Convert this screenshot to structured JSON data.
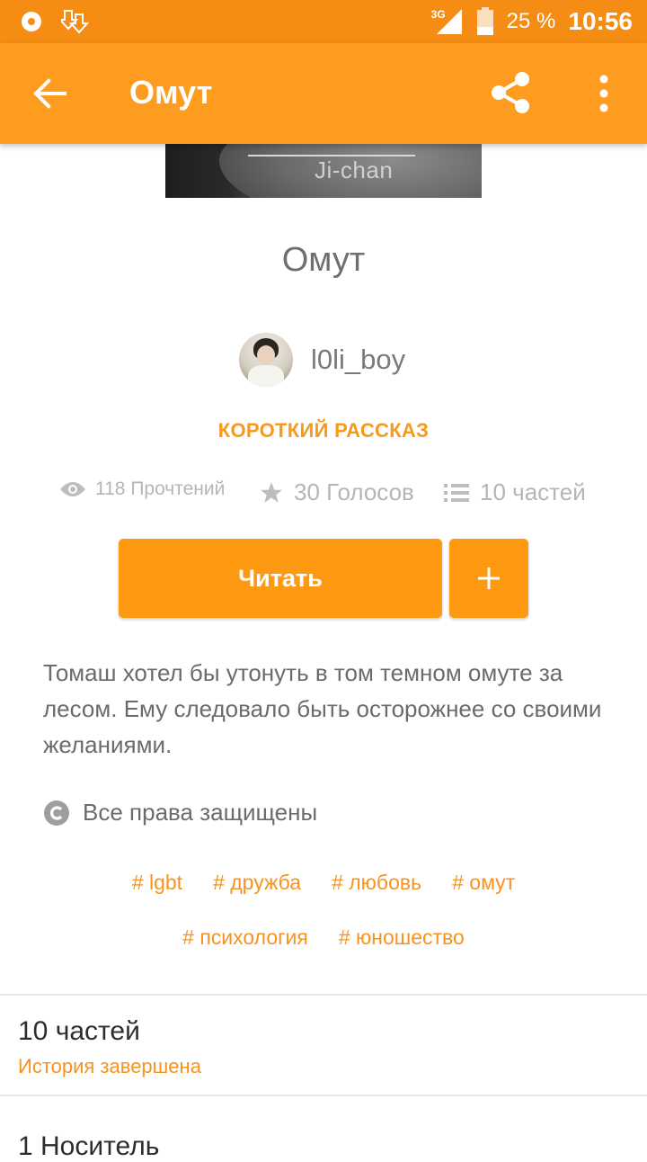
{
  "status_bar": {
    "network": "3G",
    "battery": "25 %",
    "time": "10:56",
    "icons": [
      "record-icon",
      "download-icon",
      "signal-icon",
      "battery-icon"
    ]
  },
  "app_bar": {
    "title": "Омут",
    "icons": [
      "back-arrow-icon",
      "share-icon",
      "more-vert-icon"
    ],
    "color": "#fd9c1e"
  },
  "cover": {
    "text": "Ji-chan"
  },
  "story": {
    "title": "Омут",
    "author": "l0li_boy",
    "category": "КОРОТКИЙ РАССКАЗ",
    "stats": {
      "reads": "118 Прочтений",
      "votes": "30 Голосов",
      "parts": "10 частей"
    },
    "read_button": "Читать",
    "add_button": "+",
    "description": "Томаш хотел бы утонуть в том темном омуте за лесом. Ему следовало быть осторожнее со своими желаниями.",
    "copyright": "Все права защищены",
    "tags": [
      "# lgbt",
      "# дружба",
      "# любовь",
      "# омут",
      "# психология",
      "# юношество"
    ]
  },
  "sections": {
    "parts_title": "10 частей",
    "parts_status": "История завершена",
    "media_title": "1 Носитель"
  },
  "colors": {
    "accent": "#fd9a12",
    "tag": "#f7931e"
  }
}
